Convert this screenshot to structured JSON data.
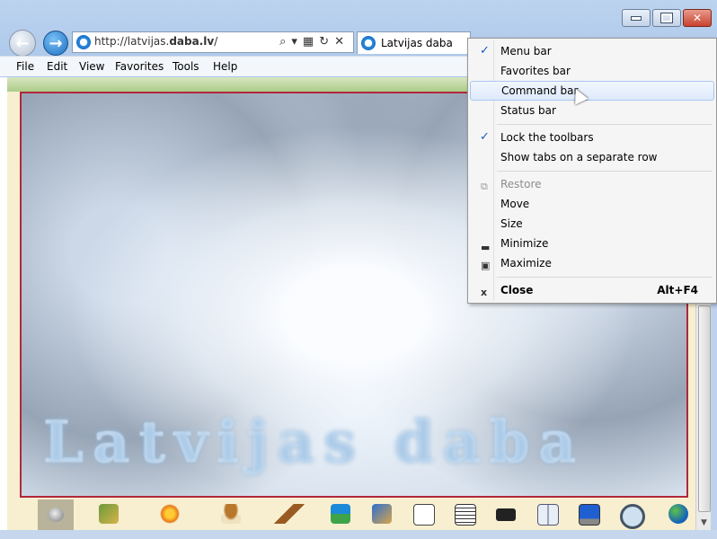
{
  "address": {
    "url_prefix": "http://latvijas.",
    "url_domain": "daba.lv",
    "url_suffix": "/"
  },
  "tab": {
    "label": "Latvijas daba"
  },
  "menubar": {
    "items": [
      "File",
      "Edit",
      "View",
      "Favorites",
      "Tools",
      "Help"
    ]
  },
  "page": {
    "banner_text": "Latvijas daba"
  },
  "context_menu": {
    "items": [
      {
        "label": "Menu bar",
        "checked": true
      },
      {
        "label": "Favorites bar"
      },
      {
        "label": "Command bar",
        "highlighted": true
      },
      {
        "label": "Status bar"
      },
      {
        "label": "Lock the toolbars",
        "checked": true
      },
      {
        "label": "Show tabs on a separate row"
      },
      {
        "label": "Restore",
        "disabled": true
      },
      {
        "label": "Move"
      },
      {
        "label": "Size"
      },
      {
        "label": "Minimize"
      },
      {
        "label": "Maximize"
      },
      {
        "label": "Close",
        "shortcut": "Alt+F4"
      }
    ]
  },
  "icon_bar": {
    "icons": [
      "coin-icon",
      "map-icon",
      "flowers-icon",
      "mushroom-icon",
      "deer-icon",
      "lake-icon",
      "paint-icon",
      "alphabet-icon",
      "table-icon",
      "camera-icon",
      "book-icon",
      "computer-icon",
      "magnifier-icon",
      "globe-icon"
    ]
  },
  "colors": {
    "photo_border": "#b0283a",
    "menu_check": "#1a5bbd",
    "page_bg": "#f7efd0"
  }
}
